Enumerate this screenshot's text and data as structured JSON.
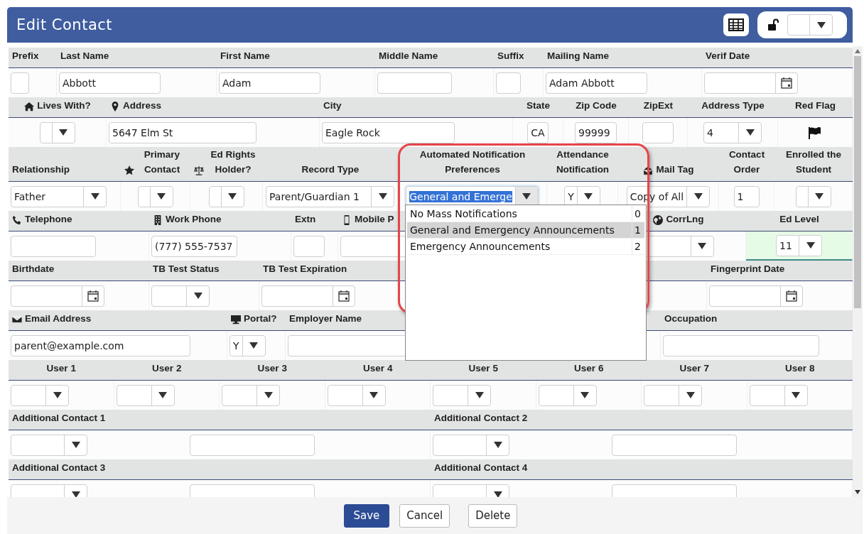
{
  "title": "Edit Contact",
  "sections": [
    {
      "columns": [
        {
          "label": "Prefix",
          "fields": [
            {
              "kind": "text"
            }
          ]
        },
        {
          "label": "Last Name",
          "fields": [
            {
              "kind": "text",
              "value": "Abbott"
            }
          ]
        },
        {
          "label": "First Name",
          "fields": [
            {
              "kind": "text",
              "value": "Adam"
            }
          ]
        },
        {
          "label": "Middle Name",
          "fields": [
            {
              "kind": "text"
            }
          ]
        },
        {
          "label": "Suffix",
          "fields": [
            {
              "kind": "text"
            }
          ]
        },
        {
          "label": "Mailing Name",
          "fields": [
            {
              "kind": "text",
              "value": "Adam Abbott"
            }
          ]
        },
        {
          "label": "Verif Date",
          "fields": [
            {
              "kind": "date"
            }
          ]
        }
      ]
    },
    {
      "columns": [
        {
          "label": "Lives With?",
          "fields": [
            {
              "kind": "select"
            }
          ]
        },
        {
          "label": "Address",
          "fields": [
            {
              "kind": "text",
              "value": "5647 Elm St"
            }
          ]
        },
        {
          "label": "City",
          "fields": [
            {
              "kind": "text",
              "value": "Eagle Rock"
            }
          ]
        },
        {
          "label": "State",
          "fields": [
            {
              "kind": "text",
              "value": "CA"
            }
          ]
        },
        {
          "label": "Zip Code",
          "fields": [
            {
              "kind": "text",
              "value": "99999"
            }
          ]
        },
        {
          "label": "ZipExt",
          "fields": [
            {
              "kind": "text"
            }
          ]
        },
        {
          "label": "Address Type",
          "fields": [
            {
              "kind": "select",
              "value": "4"
            }
          ]
        },
        {
          "label": "Red Flag",
          "fields": [
            {
              "kind": "flag"
            }
          ]
        }
      ]
    },
    {
      "columns": [
        {
          "label": "Relationship",
          "fields": [
            {
              "kind": "select",
              "value": "Father"
            }
          ]
        },
        {
          "label": "Primary Contact",
          "fields": [
            {
              "kind": "select"
            }
          ]
        },
        {
          "label": "Ed Rights Holder?",
          "fields": [
            {
              "kind": "select"
            }
          ]
        },
        {
          "label": "Record Type",
          "fields": [
            {
              "kind": "select",
              "value": "Parent/Guardian 1"
            }
          ]
        },
        {
          "label": "Automated Notification Preferences",
          "fields": [
            {
              "kind": "select",
              "value": "General and Emerge",
              "focused": true
            }
          ]
        },
        {
          "label": "Attendance Notification",
          "fields": [
            {
              "kind": "select",
              "value": "Y"
            }
          ]
        },
        {
          "label": "Mail Tag",
          "fields": [
            {
              "kind": "select",
              "value": "Copy of All"
            }
          ]
        },
        {
          "label": "Contact Order",
          "fields": [
            {
              "kind": "text",
              "value": "1"
            }
          ]
        },
        {
          "label": "Enrolled the Student",
          "fields": [
            {
              "kind": "select"
            }
          ]
        }
      ]
    },
    {
      "columns": [
        {
          "label": "Telephone",
          "fields": [
            {
              "kind": "text"
            }
          ]
        },
        {
          "label": "Work Phone",
          "fields": [
            {
              "kind": "text",
              "value": "(777) 555-7537"
            }
          ]
        },
        {
          "label": "Extn",
          "fields": [
            {
              "kind": "text"
            }
          ]
        },
        {
          "label": "Mobile P",
          "fields": [
            {
              "kind": "text"
            }
          ]
        },
        {
          "label": "CorrLng",
          "fields": [
            {
              "kind": "select"
            }
          ]
        },
        {
          "label": "Ed Level",
          "fields": [
            {
              "kind": "select",
              "value": "11",
              "highlighted": true
            }
          ]
        }
      ]
    },
    {
      "columns": [
        {
          "label": "Birthdate",
          "fields": [
            {
              "kind": "date"
            }
          ]
        },
        {
          "label": "TB Test Status",
          "fields": [
            {
              "kind": "select"
            }
          ]
        },
        {
          "label": "TB Test Expiration",
          "fields": [
            {
              "kind": "date"
            }
          ]
        },
        {
          "label": "Fingerprint Date",
          "fields": [
            {
              "kind": "date"
            }
          ]
        }
      ]
    },
    {
      "columns": [
        {
          "label": "Email Address",
          "fields": [
            {
              "kind": "text",
              "value": "parent@example.com"
            }
          ]
        },
        {
          "label": "Portal?",
          "fields": [
            {
              "kind": "select",
              "value": "Y"
            }
          ]
        },
        {
          "label": "Employer Name",
          "fields": [
            {
              "kind": "text"
            }
          ]
        },
        {
          "label": "Occupation",
          "fields": [
            {
              "kind": "text"
            }
          ]
        }
      ]
    },
    {
      "columns": [
        {
          "label": "User 1",
          "fields": [
            {
              "kind": "select"
            }
          ]
        },
        {
          "label": "User 2",
          "fields": [
            {
              "kind": "select"
            }
          ]
        },
        {
          "label": "User 3",
          "fields": [
            {
              "kind": "select"
            }
          ]
        },
        {
          "label": "User 4",
          "fields": [
            {
              "kind": "select"
            }
          ]
        },
        {
          "label": "User 5",
          "fields": [
            {
              "kind": "select"
            }
          ]
        },
        {
          "label": "User 6",
          "fields": [
            {
              "kind": "select"
            }
          ]
        },
        {
          "label": "User 7",
          "fields": [
            {
              "kind": "select"
            }
          ]
        },
        {
          "label": "User 8",
          "fields": [
            {
              "kind": "select"
            }
          ]
        }
      ]
    },
    {
      "columns": [
        {
          "label": "Additional Contact 1",
          "fields": [
            {
              "kind": "select"
            },
            {
              "kind": "text"
            }
          ]
        },
        {
          "label": "Additional Contact 2",
          "fields": [
            {
              "kind": "select"
            },
            {
              "kind": "text"
            }
          ]
        }
      ]
    },
    {
      "columns": [
        {
          "label": "Additional Contact 3",
          "fields": [
            {
              "kind": "select"
            },
            {
              "kind": "text"
            }
          ]
        },
        {
          "label": "Additional Contact 4",
          "fields": [
            {
              "kind": "select"
            },
            {
              "kind": "text"
            }
          ]
        }
      ]
    }
  ],
  "dropdown": {
    "options": [
      {
        "label": "No Mass Notifications",
        "code": "0",
        "selected": false
      },
      {
        "label": "General and Emergency Announcements",
        "code": "1",
        "selected": true
      },
      {
        "label": "Emergency Announcements",
        "code": "2",
        "selected": false
      }
    ]
  },
  "buttons": [
    {
      "label": "Save",
      "kind": "primary"
    },
    {
      "label": "Cancel",
      "kind": "default"
    },
    {
      "label": "Delete",
      "kind": "default"
    }
  ]
}
